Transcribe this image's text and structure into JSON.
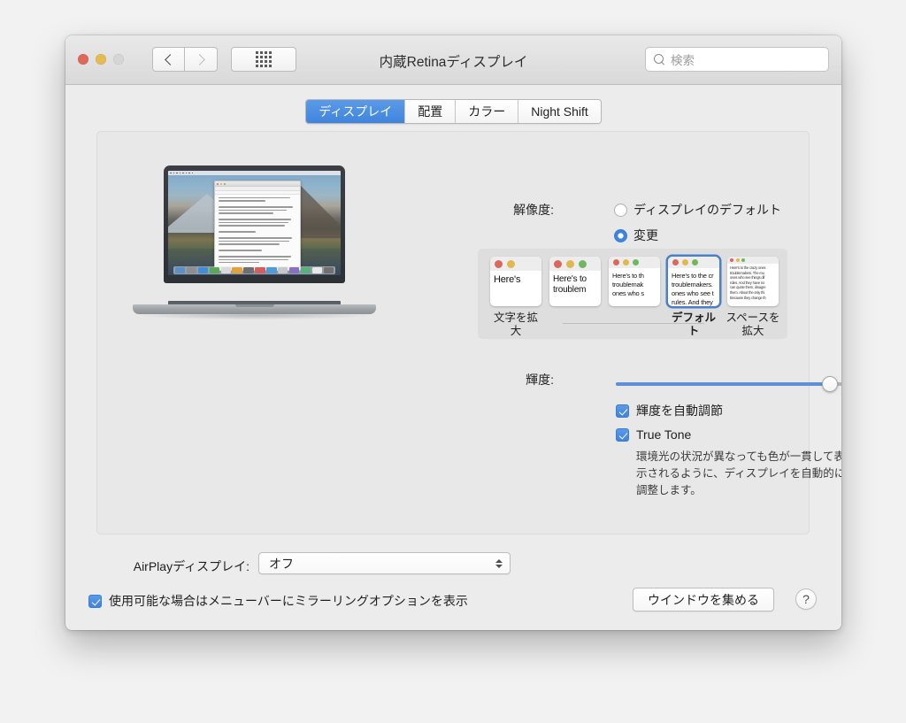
{
  "window": {
    "title": "内蔵Retinaディスプレイ",
    "traffic_lights": [
      "close",
      "minimize",
      "zoom"
    ],
    "nav": {
      "back": "back-chevron",
      "forward": "forward-chevron"
    },
    "grid_button": "show-all-grid-icon",
    "search": {
      "icon": "search-icon",
      "placeholder": "検索",
      "value": ""
    }
  },
  "tabs": [
    {
      "label": "ディスプレイ",
      "active": true
    },
    {
      "label": "配置",
      "active": false
    },
    {
      "label": "カラー",
      "active": false
    },
    {
      "label": "Night Shift",
      "active": false
    }
  ],
  "resolution": {
    "label": "解像度:",
    "options": [
      {
        "label": "ディスプレイのデフォルト",
        "selected": false
      },
      {
        "label": "変更",
        "selected": true
      }
    ]
  },
  "scale_picker": {
    "thumbnails": [
      {
        "label": "文字を拡大",
        "selected": false,
        "dots": 2,
        "lines": [
          "Here's"
        ]
      },
      {
        "label": "",
        "selected": false,
        "dots": 3,
        "lines": [
          "Here's to",
          "troublem"
        ]
      },
      {
        "label": "",
        "selected": false,
        "dots": 3,
        "lines": [
          "Here's to th",
          "troublemak",
          "ones who s"
        ]
      },
      {
        "label": "デフォルト",
        "selected": true,
        "dots": 3,
        "lines": [
          "Here's to the cr",
          "troublemakers.",
          "ones who see t",
          "rules. And they"
        ]
      },
      {
        "label": "スペースを拡大",
        "selected": false,
        "dots": 3,
        "lines": [
          "Here's to the crazy ones",
          "troublemakers. The rou",
          "ones who see things dif",
          "rules. And they have no",
          "can quote them, disagre",
          "them. About the only thi",
          "Because they change th"
        ]
      }
    ],
    "dot_colors": [
      "#d9685f",
      "#e3b750",
      "#6fb860"
    ]
  },
  "brightness": {
    "label": "輝度:",
    "value_percent": 89,
    "auto_adjust": {
      "label": "輝度を自動調節",
      "checked": true
    },
    "true_tone": {
      "label": "True Tone",
      "checked": true
    },
    "description": "環境光の状況が異なっても色が一貫して表示されるように、ディスプレイを自動的に調整します。"
  },
  "airplay": {
    "label": "AirPlayディスプレイ:",
    "value": "オフ",
    "stepper_icon": "up-down-chevron-icon"
  },
  "mirroring": {
    "label": "使用可能な場合はメニューバーにミラーリングオプションを表示",
    "checked": true
  },
  "buttons": {
    "gather_windows": "ウインドウを集める",
    "help": "?"
  },
  "illustration": {
    "device": "macbook-pro",
    "wallpaper": "high-sierra-mountain-lake",
    "foreground_app": "textedit-window"
  },
  "colors": {
    "accent": "#3f84dd",
    "tab_active": "#4d8ce0",
    "panel_bg": "#e8e8e8",
    "window_bg": "#ececec"
  }
}
